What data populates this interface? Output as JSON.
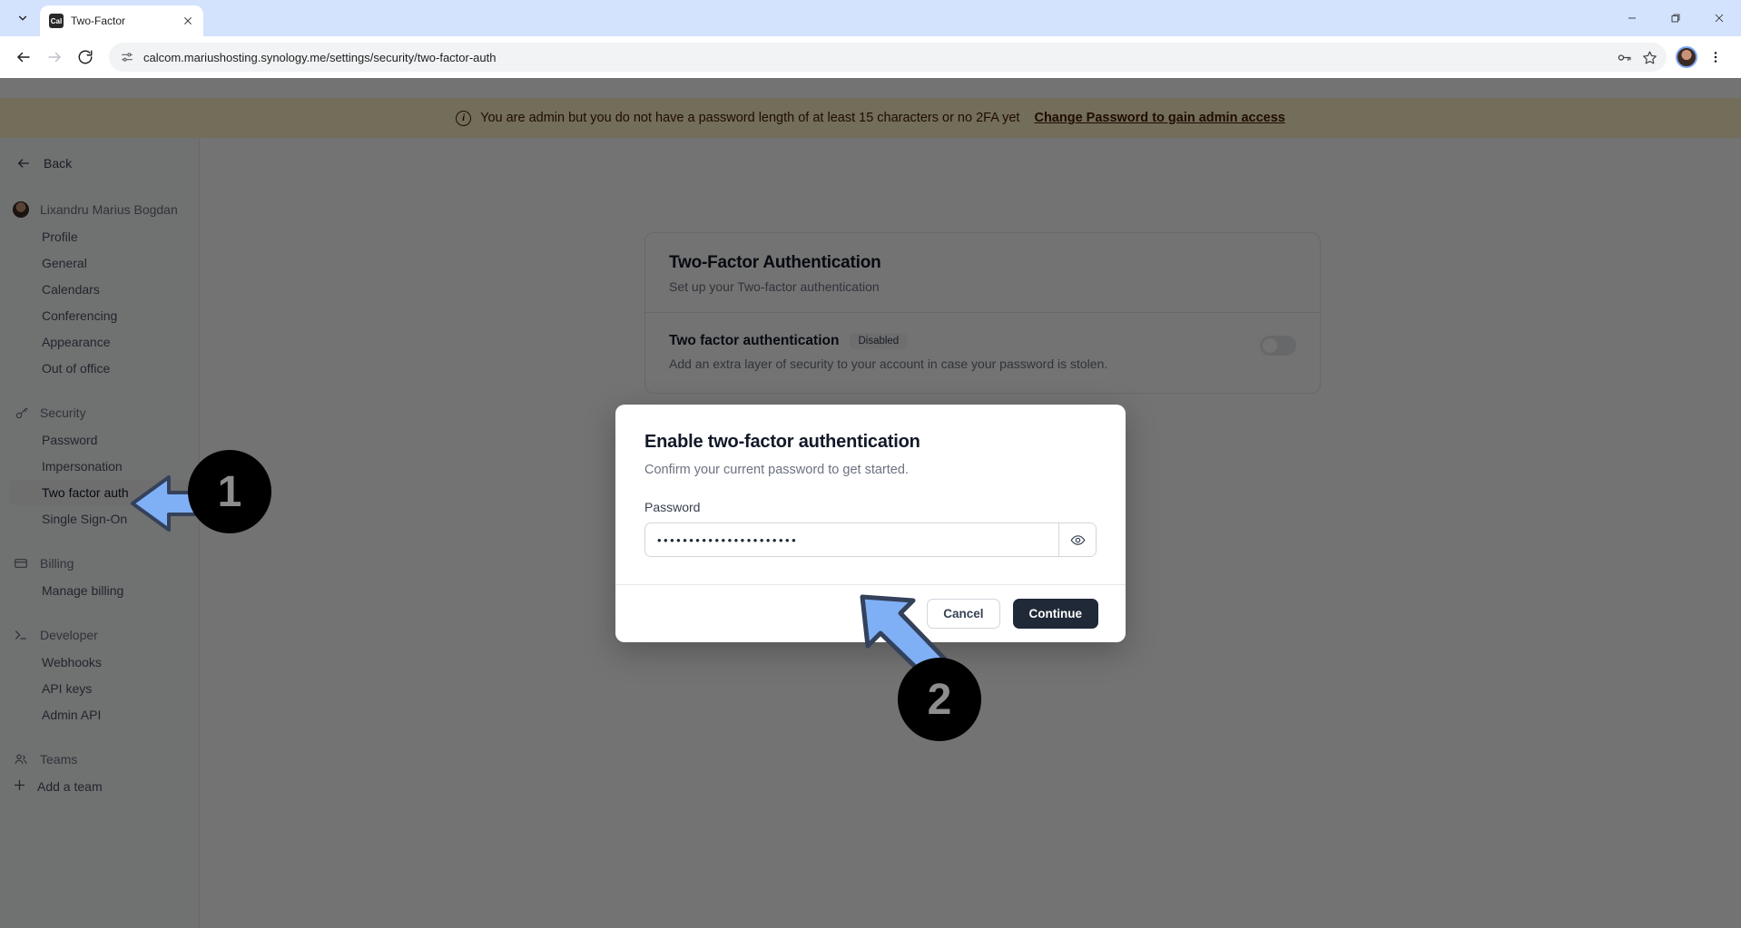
{
  "browser": {
    "tab": {
      "title": "Two-Factor",
      "favicon_text": "Cal",
      "favicon_name": "calcom-favicon"
    },
    "url": "calcom.mariushosting.synology.me/settings/security/two-factor-auth",
    "nav": {
      "back": "back-arrow-icon",
      "forward": "forward-arrow-icon",
      "reload": "reload-icon",
      "site_info": "site-settings-icon"
    },
    "omnibox_actions": [
      "password-key-icon",
      "bookmark-star-icon"
    ],
    "toolbar_right": [
      "profile-avatar",
      "kebab-menu-icon"
    ],
    "window_controls": {
      "minimize": "—",
      "maximize": "❐",
      "close": "✕"
    }
  },
  "banner": {
    "icon": "info-icon",
    "text": "You are admin but you do not have a password length of at least 15 characters or no 2FA yet",
    "link": "Change Password to gain admin access",
    "bg": "#fef3c7",
    "fg": "#451a03"
  },
  "sidebar": {
    "back_label": "Back",
    "groups": [
      {
        "icon": "user-avatar-icon",
        "label": "Lixandru Marius Bogdan",
        "items": [
          {
            "label": "Profile",
            "active": false
          },
          {
            "label": "General",
            "active": false
          },
          {
            "label": "Calendars",
            "active": false
          },
          {
            "label": "Conferencing",
            "active": false
          },
          {
            "label": "Appearance",
            "active": false
          },
          {
            "label": "Out of office",
            "active": false
          }
        ]
      },
      {
        "icon": "key-icon",
        "label": "Security",
        "items": [
          {
            "label": "Password",
            "active": false
          },
          {
            "label": "Impersonation",
            "active": false
          },
          {
            "label": "Two factor auth",
            "active": true
          },
          {
            "label": "Single Sign-On",
            "active": false
          }
        ]
      },
      {
        "icon": "credit-card-icon",
        "label": "Billing",
        "items": [
          {
            "label": "Manage billing",
            "active": false
          }
        ]
      },
      {
        "icon": "terminal-icon",
        "label": "Developer",
        "items": [
          {
            "label": "Webhooks",
            "active": false
          },
          {
            "label": "API keys",
            "active": false
          },
          {
            "label": "Admin API",
            "active": false
          }
        ]
      },
      {
        "icon": "users-icon",
        "label": "Teams",
        "items": []
      }
    ],
    "add_team": {
      "icon": "plus-icon",
      "label": "Add a team"
    }
  },
  "main": {
    "card": {
      "title": "Two-Factor Authentication",
      "subtitle": "Set up your Two-factor authentication",
      "row": {
        "title": "Two factor authentication",
        "badge": "Disabled",
        "description": "Add an extra layer of security to your account in case your password is stolen.",
        "toggle_state": "off"
      }
    }
  },
  "modal": {
    "title": "Enable two-factor authentication",
    "subtitle": "Confirm your current password to get started.",
    "password_label": "Password",
    "password_value": "••••••••••••••••••••••",
    "password_placeholder": "",
    "eye_icon": "eye-icon",
    "cancel_label": "Cancel",
    "continue_label": "Continue"
  },
  "annotations": {
    "step1": "1",
    "step2": "2",
    "arrow_fill": "#7fb0f5",
    "arrow_stroke": "#34415a",
    "badge_bg": "#000000",
    "badge_fg": "#8d8d8d"
  }
}
